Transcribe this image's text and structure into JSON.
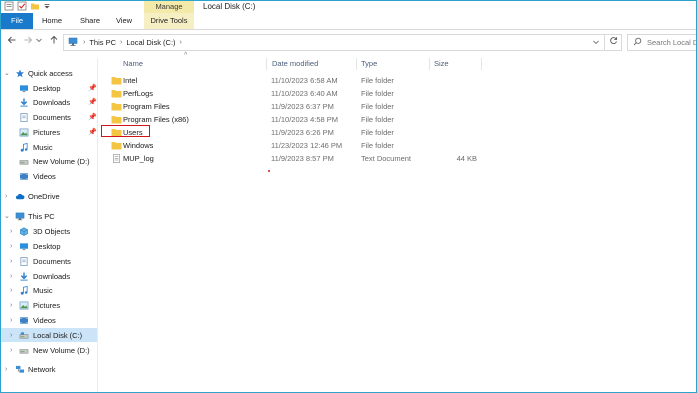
{
  "window": {
    "title": "Local Disk (C:)",
    "context_tab": "Manage"
  },
  "ribbon": {
    "tabs": [
      "File",
      "Home",
      "Share",
      "View",
      "Drive Tools"
    ]
  },
  "nav": {
    "back_icon": "arrow-left-icon",
    "forward_icon": "arrow-right-icon",
    "recent_icon": "chevron-down-icon",
    "up_icon": "arrow-up-icon",
    "breadcrumb": [
      "This PC",
      "Local Disk (C:)"
    ],
    "search_placeholder": "Search Local Disk (C:)"
  },
  "columns": {
    "name": "Name",
    "date": "Date modified",
    "type": "Type",
    "size": "Size"
  },
  "files": [
    {
      "name": "Intel",
      "date": "11/10/2023 6:58 AM",
      "type": "File folder",
      "size": "",
      "icon": "folder-icon"
    },
    {
      "name": "PerfLogs",
      "date": "11/10/2023 6:40 AM",
      "type": "File folder",
      "size": "",
      "icon": "folder-icon"
    },
    {
      "name": "Program Files",
      "date": "11/9/2023 6:37 PM",
      "type": "File folder",
      "size": "",
      "icon": "folder-icon"
    },
    {
      "name": "Program Files (x86)",
      "date": "11/10/2023 4:58 PM",
      "type": "File folder",
      "size": "",
      "icon": "folder-icon"
    },
    {
      "name": "Users",
      "date": "11/9/2023 6:26 PM",
      "type": "File folder",
      "size": "",
      "icon": "folder-icon"
    },
    {
      "name": "Windows",
      "date": "11/23/2023 12:46 PM",
      "type": "File folder",
      "size": "",
      "icon": "folder-icon"
    },
    {
      "name": "MUP_log",
      "date": "11/9/2023 8:57 PM",
      "type": "Text Document",
      "size": "44 KB",
      "icon": "text-document-icon"
    }
  ],
  "sidebar": {
    "items": [
      {
        "label": "Quick access",
        "icon": "star-icon"
      },
      {
        "label": "Desktop",
        "icon": "desktop-icon",
        "pinned": true
      },
      {
        "label": "Downloads",
        "icon": "download-icon",
        "pinned": true
      },
      {
        "label": "Documents",
        "icon": "documents-icon",
        "pinned": true
      },
      {
        "label": "Pictures",
        "icon": "pictures-icon",
        "pinned": true
      },
      {
        "label": "Music",
        "icon": "music-icon"
      },
      {
        "label": "New Volume (D:)",
        "icon": "drive-icon"
      },
      {
        "label": "Videos",
        "icon": "videos-icon"
      },
      {
        "label": "OneDrive",
        "icon": "cloud-icon"
      },
      {
        "label": "This PC",
        "icon": "computer-icon"
      },
      {
        "label": "3D Objects",
        "icon": "cube-icon"
      },
      {
        "label": "Desktop",
        "icon": "desktop-icon"
      },
      {
        "label": "Documents",
        "icon": "documents-icon"
      },
      {
        "label": "Downloads",
        "icon": "download-icon"
      },
      {
        "label": "Music",
        "icon": "music-icon"
      },
      {
        "label": "Pictures",
        "icon": "pictures-icon"
      },
      {
        "label": "Videos",
        "icon": "videos-icon"
      },
      {
        "label": "Local Disk (C:)",
        "icon": "drive-icon",
        "selected": true
      },
      {
        "label": "New Volume (D:)",
        "icon": "drive-icon"
      },
      {
        "label": "Network",
        "icon": "network-icon"
      }
    ]
  },
  "colors": {
    "accent": "#1979ca",
    "selection": "#cce4f7",
    "folder": "#f4c542",
    "highlight_box": "#d0161d",
    "manage_tab": "#f3e9a8"
  }
}
